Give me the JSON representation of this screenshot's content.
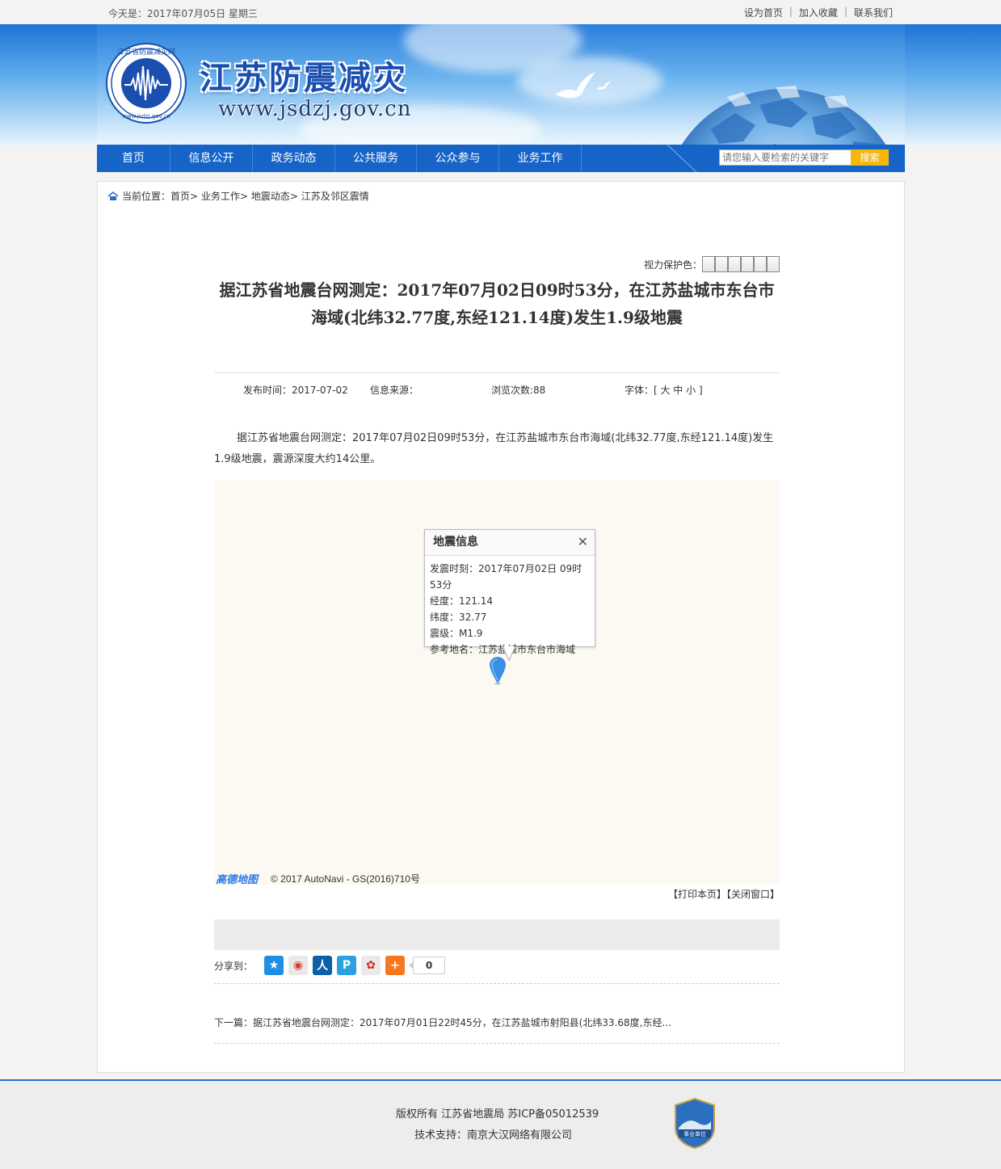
{
  "topbar": {
    "date": "今天是：2017年07月05日  星期三",
    "links": [
      "设为首页",
      "加入收藏",
      "联系我们"
    ]
  },
  "banner": {
    "title": "江苏防震减灾",
    "url": "www.jsdzj.gov.cn",
    "logo_text": "江苏省防震减灾网",
    "logo_url": "www.jsdzj.gov.cn"
  },
  "nav": {
    "items": [
      "首页",
      "信息公开",
      "政务动态",
      "公共服务",
      "公众参与",
      "业务工作"
    ],
    "search_placeholder": "请您输入要检索的关键字",
    "search_button": "搜索"
  },
  "breadcrumb": {
    "prefix": "当前位置：",
    "path": [
      "首页",
      "业务工作",
      "地震动态",
      "江苏及邻区震情"
    ]
  },
  "eye_protect": {
    "label": "视力保护色：",
    "colors": [
      "#f0f0f0",
      "#f0f0f0",
      "#f0f0f0",
      "#f0f0f0",
      "#f0f0f0",
      "#f0f0f0"
    ]
  },
  "article": {
    "title": "据江苏省地震台网测定：2017年07月02日09时53分，在江苏盐城市东台市海域(北纬32.77度,东经121.14度)发生1.9级地震",
    "publish_time": "发布时间：2017-07-02",
    "source": "信息来源：",
    "views": "浏览次数:88",
    "font_label": "字体：[ 大  中  小 ]",
    "body": "据江苏省地震台网测定：2017年07月02日09时53分，在江苏盐城市东台市海域(北纬32.77度,东经121.14度)发生1.9级地震，震源深度大约14公里。"
  },
  "map": {
    "popup_title": "地震信息",
    "rows": [
      "发震时刻：2017年07月02日 09时53分",
      "经度：121.14",
      "纬度：32.77",
      "震级：M1.9",
      "参考地名：江苏盐城市东台市海域"
    ],
    "logo": "高德地图",
    "copyright": "© 2017 AutoNavi  - GS(2016)710号"
  },
  "print_links": [
    "【打印本页】",
    "【关闭窗口】"
  ],
  "share": {
    "label": "分享到：",
    "count": "0",
    "icons": [
      {
        "name": "qzone-icon",
        "color": "#1f8fe5"
      },
      {
        "name": "weibo-icon",
        "color": "#e6e6e6"
      },
      {
        "name": "renren-icon",
        "color": "#0d5fa8"
      },
      {
        "name": "pengyou-icon",
        "color": "#2aa1e0"
      },
      {
        "name": "sohu-icon",
        "color": "#e6e6e6"
      },
      {
        "name": "more-icon",
        "color": "#f5781f"
      }
    ]
  },
  "next_article": "下一篇：据江苏省地震台网测定：2017年07月01日22时45分，在江苏盐城市射阳县(北纬33.68度,东经...",
  "footer": {
    "line1": "版权所有  江苏省地震局  苏ICP备05012539",
    "line2": "技术支持：南京大汉网络有限公司",
    "badge": "事业单位"
  }
}
